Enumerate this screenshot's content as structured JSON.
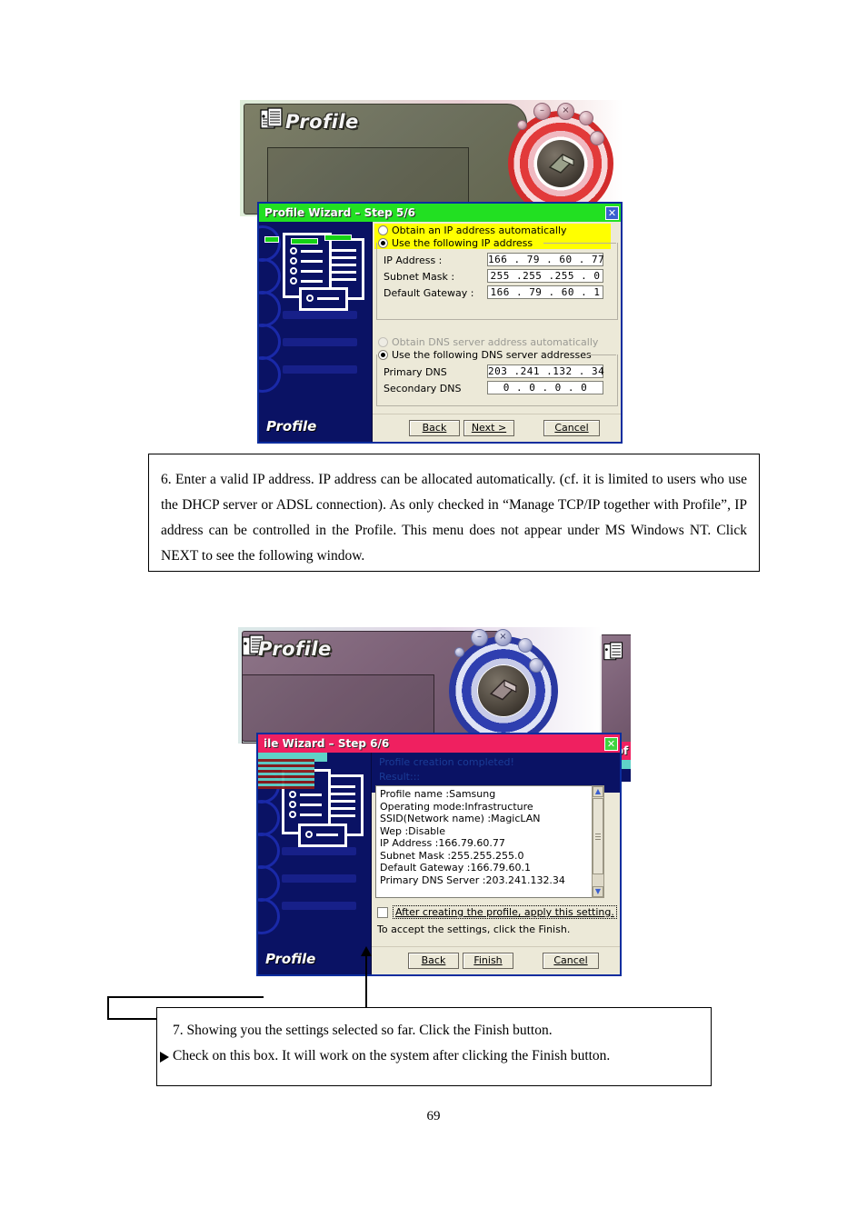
{
  "page": {
    "number": "69"
  },
  "figure_one": {
    "skin_window": {
      "title": "Profile",
      "icon": "profile-doc-icon",
      "minimize_label": "–",
      "close_label": "×",
      "accent_color": "#6f7260"
    },
    "dialog": {
      "title": "Profile Wizard – Step 5/6",
      "title_bar_color": "#22e022",
      "close_label": "✕",
      "sidebar_label": "Profile",
      "ip_section": {
        "option_auto": "Obtain an IP address automatically",
        "option_manual": "Use the following IP address",
        "selected": "Use the following IP address",
        "fields": [
          {
            "label": "IP Address :",
            "value": "166 . 79 . 60 . 77"
          },
          {
            "label": "Subnet Mask :",
            "value": "255 .255 .255 . 0"
          },
          {
            "label": "Default Gateway :",
            "value": "166 . 79 . 60 . 1"
          }
        ]
      },
      "dns_section": {
        "option_auto": "Obtain DNS server address automatically",
        "option_manual": "Use the following DNS server addresses",
        "selected": "Use the following DNS server addresses",
        "fields": [
          {
            "label": "Primary DNS",
            "value": "203 .241 .132 . 34"
          },
          {
            "label": "Secondary DNS",
            "value": "0  .  0  .  0  .  0"
          }
        ]
      },
      "buttons": {
        "back": "Back",
        "next": "Next >",
        "cancel": "Cancel"
      }
    }
  },
  "caption_one": {
    "text": "6. Enter a valid IP address. IP address can be allocated automatically. (cf. it is limited to users who use the DHCP server or ADSL connection). As only checked in “Manage TCP/IP together with Profile”, IP address can be controlled in the Profile. This menu does not appear under MS Windows NT. Click NEXT to see the following window."
  },
  "figure_two": {
    "skin_window": {
      "title": "Profile",
      "icon": "profile-doc-icon",
      "minimize_label": "–",
      "close_label": "×",
      "accent_color": "#7e6379"
    },
    "peek_window": {
      "title": "Prof"
    },
    "dialog": {
      "title": "ile Wizard – Step 6/6",
      "title_bar_color": "#ef2060",
      "close_label": "✕",
      "sidebar_label": "Profile",
      "header_line_1": "Profile creation completed!",
      "header_line_2": "Result:::",
      "summary": [
        "Profile name :Samsung",
        "Operating mode:Infrastructure",
        "SSID(Network name) :MagicLAN",
        "Wep :Disable",
        "IP Address :166.79.60.77",
        "Subnet Mask :255.255.255.0",
        "Default Gateway :166.79.60.1",
        "Primary DNS Server :203.241.132.34"
      ],
      "apply_checkbox": {
        "label": "After creating the profile, apply this setting.",
        "checked": false
      },
      "note": "To accept the settings, click the Finish.",
      "buttons": {
        "back": "Back",
        "finish": "Finish",
        "cancel": "Cancel"
      },
      "scrollbar": {
        "up_arrow": "▲",
        "down_arrow": "▼"
      }
    }
  },
  "caption_two": {
    "line_1": "7.  Showing you the settings selected so far.  Click the Finish button.",
    "line_2": "Check on this box. It will work on the system after clicking the Finish button."
  }
}
